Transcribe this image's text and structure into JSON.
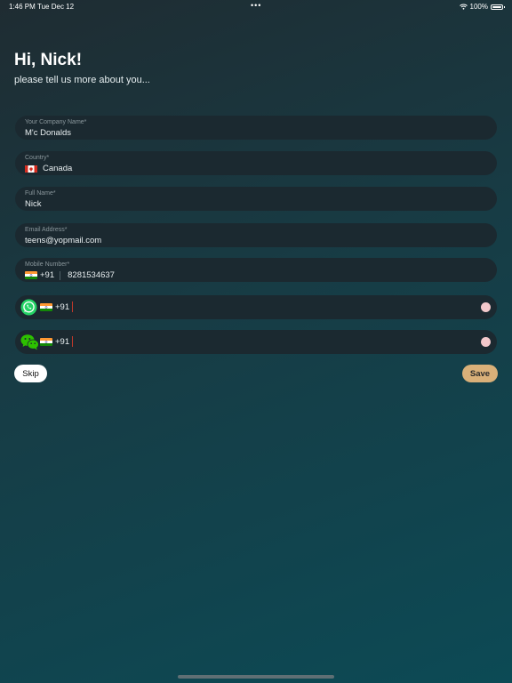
{
  "status_bar": {
    "time": "1:46 PM",
    "date": "Tue Dec 12",
    "dots": "•••",
    "battery_percent": "100%"
  },
  "header": {
    "greeting": "Hi, Nick!",
    "subtitle": "please tell us more about you..."
  },
  "form": {
    "company": {
      "label": "Your Company Name*",
      "value": "M'c Donalds"
    },
    "country": {
      "label": "Country*",
      "value": "Canada",
      "flag": "canada-flag"
    },
    "full_name": {
      "label": "Full Name*",
      "value": "Nick"
    },
    "email": {
      "label": "Email Address*",
      "value": "teens@yopmail.com"
    },
    "mobile": {
      "label": "Mobile Number*",
      "code": "+91",
      "value": "8281534637",
      "flag": "india-flag"
    },
    "whatsapp": {
      "icon": "whatsapp-icon",
      "code": "+91",
      "flag": "india-flag",
      "value": ""
    },
    "wechat": {
      "icon": "wechat-icon",
      "code": "+91",
      "flag": "india-flag",
      "value": ""
    }
  },
  "actions": {
    "skip_label": "Skip",
    "save_label": "Save"
  },
  "colors": {
    "background_top": "#1f2c32",
    "background_bottom": "#0c4a55",
    "field_bg": "#1b2930",
    "save_accent": "#d9b079",
    "whatsapp_green": "#25d366",
    "wechat_green": "#2dc100"
  }
}
